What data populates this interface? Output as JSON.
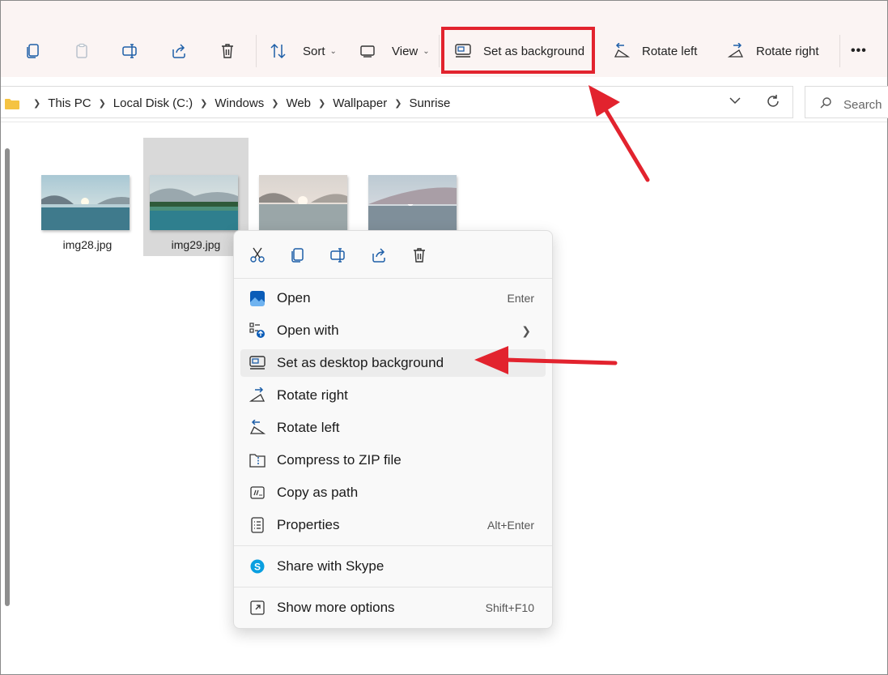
{
  "toolbar": {
    "copy_icon": "copy-icon",
    "paste_icon": "paste-icon",
    "rename_icon": "rename-icon",
    "share_icon": "share-icon",
    "delete_icon": "delete-icon",
    "sort_label": "Sort",
    "view_label": "View",
    "set_bg_label": "Set as background",
    "rotate_left_label": "Rotate left",
    "rotate_right_label": "Rotate right",
    "more_label": "•••"
  },
  "address": {
    "crumbs": [
      "This PC",
      "Local Disk (C:)",
      "Windows",
      "Web",
      "Wallpaper",
      "Sunrise"
    ],
    "search_placeholder": "Search"
  },
  "files": [
    {
      "name": "img28.jpg",
      "selected": false
    },
    {
      "name": "img29.jpg",
      "selected": true
    },
    {
      "name": "",
      "selected": false
    },
    {
      "name": "",
      "selected": false
    }
  ],
  "context_menu": {
    "items": [
      {
        "label": "Open",
        "shortcut": "Enter"
      },
      {
        "label": "Open with",
        "shortcut": ""
      },
      {
        "label": "Set as desktop background",
        "shortcut": ""
      },
      {
        "label": "Rotate right",
        "shortcut": ""
      },
      {
        "label": "Rotate left",
        "shortcut": ""
      },
      {
        "label": "Compress to ZIP file",
        "shortcut": ""
      },
      {
        "label": "Copy as path",
        "shortcut": ""
      },
      {
        "label": "Properties",
        "shortcut": "Alt+Enter"
      },
      {
        "label": "Share with Skype",
        "shortcut": ""
      },
      {
        "label": "Show more options",
        "shortcut": "Shift+F10"
      }
    ]
  },
  "colors": {
    "accent": "#0067c0",
    "highlight_red": "#e2232e",
    "toolbar_bg": "#fbf4f3",
    "selection_bg": "#d9d9d9"
  }
}
